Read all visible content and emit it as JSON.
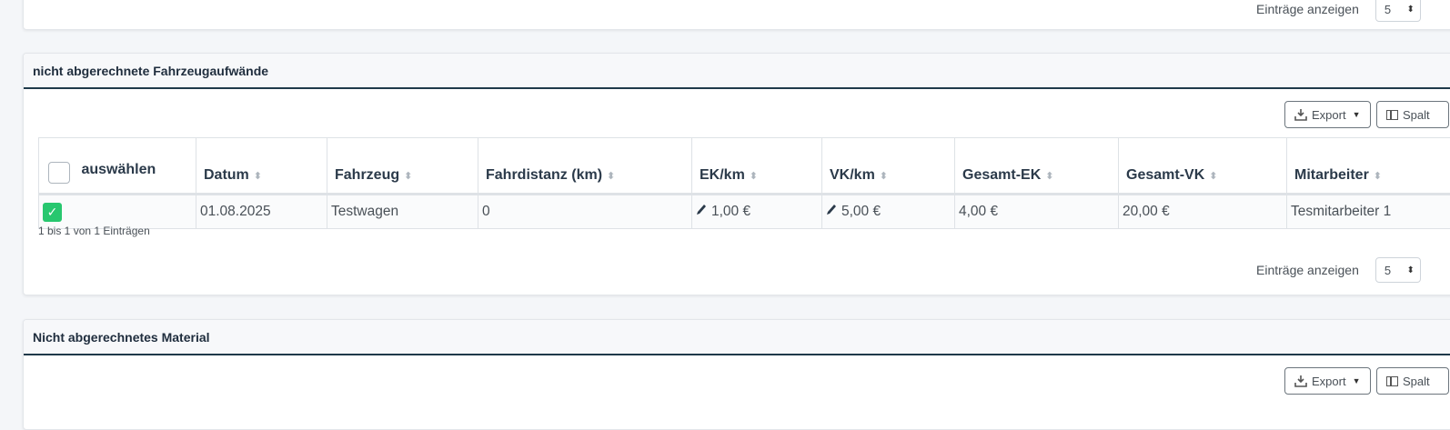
{
  "top": {
    "len_label": "Einträge anzeigen",
    "len_value": "5"
  },
  "vehicle": {
    "title": "nicht abgerechnete Fahrzeugaufwände",
    "export_label": "Export",
    "columns_label": "Spalt",
    "headers": {
      "select": "auswählen",
      "datum": "Datum",
      "fahrzeug": "Fahrzeug",
      "distanz": "Fahrdistanz (km)",
      "ek": "EK/km",
      "vk": "VK/km",
      "gesamt_ek": "Gesamt-EK",
      "gesamt_vk": "Gesamt-VK",
      "mitarbeiter": "Mitarbeiter"
    },
    "rows": [
      {
        "checked": true,
        "datum": "01.08.2025",
        "fahrzeug": "Testwagen",
        "distanz": "0",
        "ek": "1,00 €",
        "vk": "5,00 €",
        "gesamt_ek": "4,00 €",
        "gesamt_vk": "20,00 €",
        "mitarbeiter": "Tesmitarbeiter 1"
      }
    ],
    "info": "1 bis 1 von 1 Einträgen",
    "len_label": "Einträge anzeigen",
    "len_value": "5"
  },
  "material": {
    "title": "Nicht abgerechnetes Material",
    "export_label": "Export",
    "columns_label": "Spalt"
  },
  "icons": {
    "sort": "sort-icon",
    "pencil": "pencil-icon",
    "download": "download-icon",
    "columns": "columns-icon"
  },
  "colors": {
    "accent_border": "#1f3a4a",
    "check_green": "#28c76f"
  }
}
